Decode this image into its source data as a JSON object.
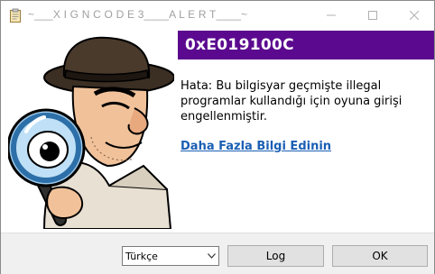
{
  "window": {
    "title": "~___X I G N C O D E 3____A L E R T____~",
    "icon": "clipboard-icon"
  },
  "titlebar_buttons": {
    "minimize_icon": "minimize-icon",
    "maximize_icon": "maximize-icon",
    "close_icon": "close-icon"
  },
  "illustration": {
    "icon": "spy-with-magnifying-glass"
  },
  "error": {
    "code": "0xE019100C",
    "message": "Hata: Bu bilgisyar geçmişte illegal programlar kullandığı için oyuna girişi engellenmiştir.",
    "link_label": "Daha Fazla Bilgi Edinin"
  },
  "footer": {
    "language_selected": "Türkçe",
    "log_label": "Log",
    "ok_label": "OK"
  },
  "colors": {
    "banner": "#5b0a8f",
    "link": "#1a5fb4",
    "footer_bg": "#f0f0f0"
  }
}
